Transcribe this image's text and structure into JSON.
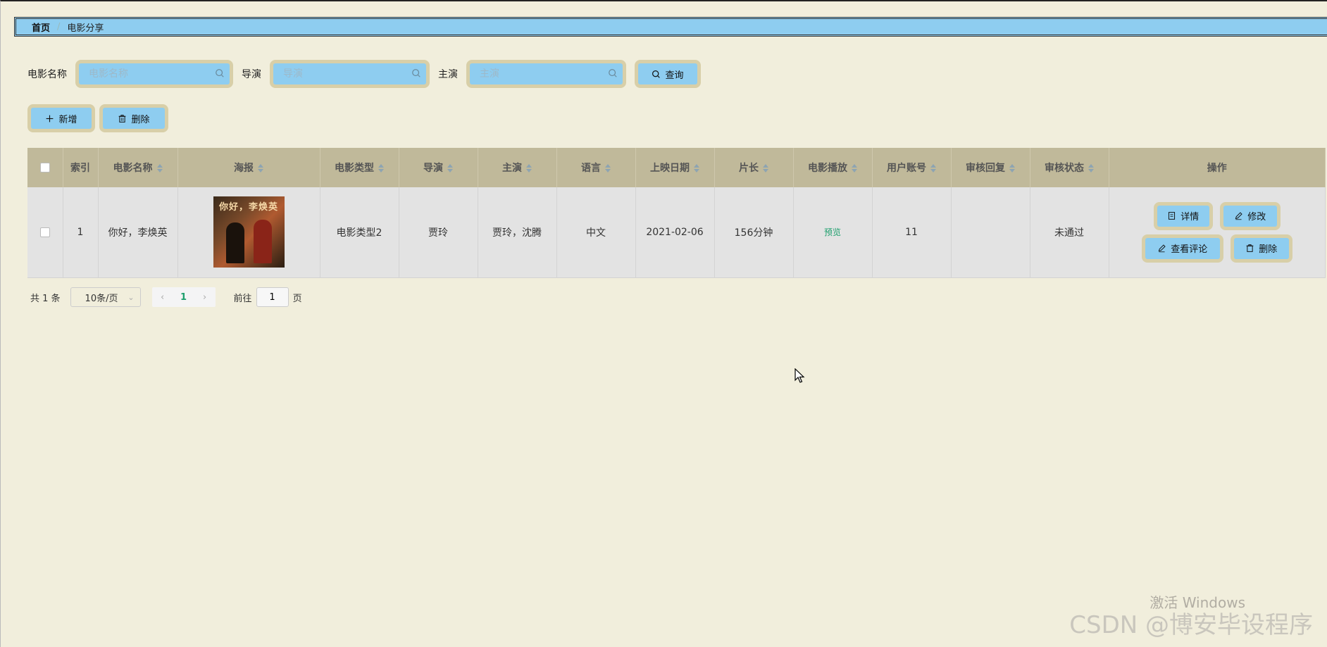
{
  "breadcrumb": {
    "home": "首页",
    "separator": "/",
    "current": "电影分享"
  },
  "search": {
    "name_label": "电影名称",
    "name_placeholder": "电影名称",
    "director_label": "导演",
    "director_placeholder": "导演",
    "actor_label": "主演",
    "actor_placeholder": "主演",
    "query_button": "查询"
  },
  "actions": {
    "add": "新增",
    "delete": "删除"
  },
  "table": {
    "headers": [
      "索引",
      "电影名称",
      "海报",
      "电影类型",
      "导演",
      "主演",
      "语言",
      "上映日期",
      "片长",
      "电影播放",
      "用户账号",
      "审核回复",
      "审核状态",
      "操作"
    ],
    "rows": [
      {
        "index": "1",
        "name": "你好，李焕英",
        "poster_title": "你好，李焕英",
        "type": "电影类型2",
        "director": "贾玲",
        "actors": "贾玲，沈腾",
        "language": "中文",
        "release_date": "2021-02-06",
        "duration": "156分钟",
        "play": "预览",
        "user_account": "11",
        "review_reply": "",
        "review_status": "未通过",
        "ops": {
          "detail": "详情",
          "edit": "修改",
          "comments": "查看评论",
          "delete": "删除"
        }
      }
    ]
  },
  "pagination": {
    "total": "共 1 条",
    "page_size": "10条/页",
    "current_page": "1",
    "goto_prefix": "前往",
    "goto_value": "1",
    "goto_suffix": "页"
  },
  "watermark": {
    "windows": "激活 Windows",
    "csdn": "CSDN @博安毕设程序"
  },
  "colors": {
    "background": "#f1eedc",
    "accent": "#8ecdf0",
    "button_frame": "#d8cfa8",
    "header_bg": "#c0b99a",
    "link": "#1e9f6e"
  }
}
